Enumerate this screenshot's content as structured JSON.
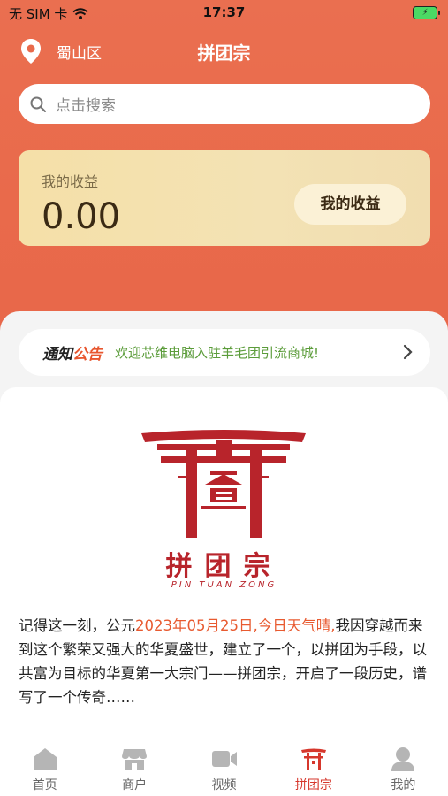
{
  "status_bar": {
    "carrier": "无 SIM 卡",
    "time": "17:37"
  },
  "nav": {
    "location": "蜀山区",
    "title": "拼团宗"
  },
  "search": {
    "placeholder": "点击搜索"
  },
  "earnings": {
    "label": "我的收益",
    "value": "0.00",
    "button": "我的收益"
  },
  "notice": {
    "badge_part1": "通知",
    "badge_part2": "公告",
    "text": "欢迎芯维电脑入驻羊毛团引流商城!"
  },
  "logo": {
    "title": "拼团宗",
    "subtitle": "PIN TUAN ZONG"
  },
  "story": {
    "part1": "记得这一刻，公元",
    "highlight": "2023年05月25日,今日天气晴,",
    "part2": "我因穿越而来到这个繁荣又强大的华夏盛世，建立了一个，以拼团为手段，以共富为目标的华夏第一大宗门——拼团宗，开启了一段历史，谱写了一个传奇……"
  },
  "tabs": [
    {
      "label": "首页",
      "icon": "home-icon"
    },
    {
      "label": "商户",
      "icon": "store-icon"
    },
    {
      "label": "视频",
      "icon": "video-icon"
    },
    {
      "label": "拼团宗",
      "icon": "torii-icon",
      "active": true
    },
    {
      "label": "我的",
      "icon": "user-icon"
    }
  ],
  "colors": {
    "primary": "#e96a4b",
    "accent": "#d6372c",
    "gold": "#f4e0aa"
  }
}
